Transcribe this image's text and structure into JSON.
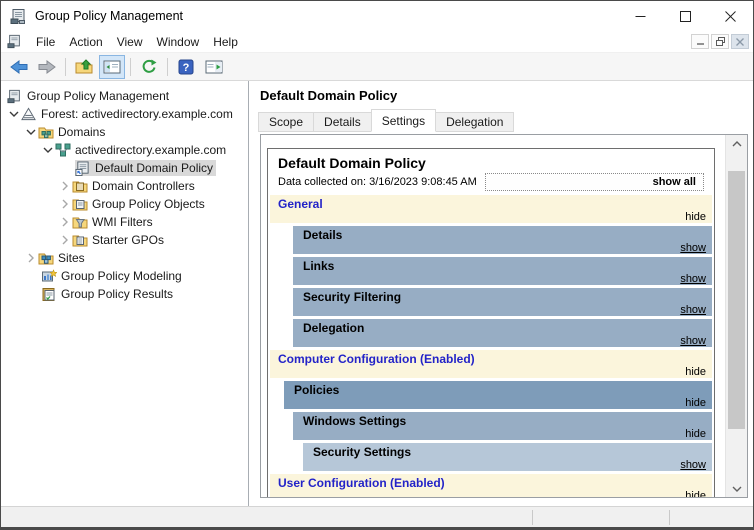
{
  "window": {
    "title": "Group Policy Management"
  },
  "menu": {
    "items": [
      "File",
      "Action",
      "View",
      "Window",
      "Help"
    ]
  },
  "toolbar": {
    "buttons": [
      "back",
      "forward",
      "up-one-level",
      "show-console-tree",
      "refresh",
      "help",
      "show-action-pane"
    ],
    "pressed_button": "show-console-tree"
  },
  "tree": {
    "items": [
      {
        "label": "Group Policy Management"
      },
      {
        "label": "Forest: activedirectory.example.com"
      },
      {
        "label": "Domains"
      },
      {
        "label": "activedirectory.example.com"
      },
      {
        "label": "Default Domain Policy"
      },
      {
        "label": "Domain Controllers"
      },
      {
        "label": "Group Policy Objects"
      },
      {
        "label": "WMI Filters"
      },
      {
        "label": "Starter GPOs"
      },
      {
        "label": "Sites"
      },
      {
        "label": "Group Policy Modeling"
      },
      {
        "label": "Group Policy Results"
      }
    ],
    "selected": "Default Domain Policy"
  },
  "content": {
    "page_title": "Default Domain Policy",
    "tabs": [
      "Scope",
      "Details",
      "Settings",
      "Delegation"
    ],
    "active_tab": "Settings",
    "report": {
      "title": "Default Domain Policy",
      "data_collected": "Data collected on: 3/16/2023 9:08:45 AM",
      "show_all": "show all",
      "sections": [
        {
          "title": "General",
          "link": "hide"
        },
        {
          "title": "Details",
          "link": "show"
        },
        {
          "title": "Links",
          "link": "show"
        },
        {
          "title": "Security Filtering",
          "link": "show"
        },
        {
          "title": "Delegation",
          "link": "show"
        },
        {
          "title": "Computer Configuration (Enabled)",
          "link": "hide"
        },
        {
          "title": "Policies",
          "link": "hide"
        },
        {
          "title": "Windows Settings",
          "link": "hide"
        },
        {
          "title": "Security Settings",
          "link": "show"
        },
        {
          "title": "User Configuration (Enabled)",
          "link": "hide"
        }
      ]
    }
  },
  "colors": {
    "section_header_bg": "#FBF5DC",
    "band_bg": "#97ADC4",
    "band_dark_bg": "#7E9CB9",
    "band_light_bg": "#B6C7D8",
    "section_heading_text": "#2323C8",
    "tree_selection_bg": "#D9D9D9",
    "toolbar_pressed_bg": "#D3E6F8"
  },
  "icons": [
    "gpm-console-icon",
    "forest-icon",
    "domains-folder-icon",
    "domain-icon",
    "gpo-shortcut-icon",
    "domain-controllers-folder-icon",
    "gpo-folder-icon",
    "wmi-filters-folder-icon",
    "starter-gpos-folder-icon",
    "sites-folder-icon",
    "modeling-icon",
    "results-icon",
    "back-icon",
    "forward-icon",
    "up-one-level-icon",
    "console-tree-icon",
    "refresh-icon",
    "help-icon",
    "action-pane-icon"
  ]
}
